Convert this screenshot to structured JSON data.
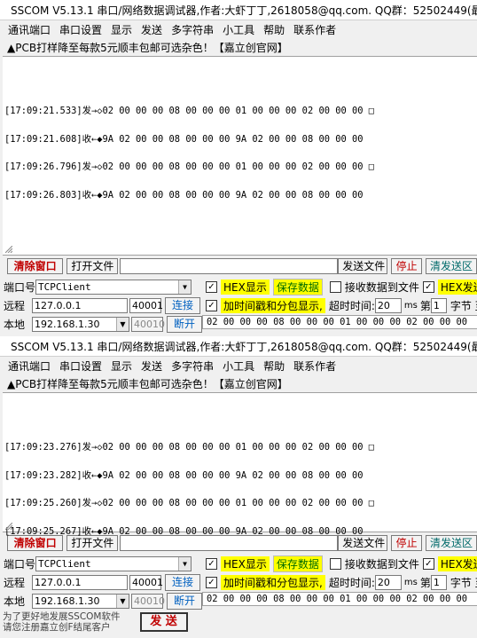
{
  "windows": [
    {
      "title": "SSCOM V5.13.1 串口/网络数据调试器,作者:大虾丁丁,2618058@qq.com. QQ群：52502449(最",
      "menu": [
        "通讯端口",
        "串口设置",
        "显示",
        "发送",
        "多字符串",
        "小工具",
        "帮助",
        "联系作者"
      ],
      "ad_text": "▲PCB打样降至每款5元顺丰包邮可选杂色！【嘉立创官网】",
      "log_lines": [
        "[17:09:21.533]发→◇02 00 00 00 08 00 00 00 01 00 00 00 02 00 00 00 □",
        "[17:09:21.608]收←◆9A 02 00 00 08 00 00 00 9A 02 00 00 08 00 00 00",
        "[17:09:26.796]发→◇02 00 00 00 08 00 00 00 01 00 00 00 02 00 00 00 □",
        "[17:09:26.803]收←◆9A 02 00 00 08 00 00 00 9A 02 00 00 08 00 00 00"
      ],
      "clear_button": "清除窗口",
      "open_file_button": "打开文件",
      "send_file_button": "发送文件",
      "stop_button": "停止",
      "clear_send_button": "清发送区",
      "port_label": "端口号",
      "port_value": "TCPClient",
      "remote_label": "远程",
      "remote_ip": "127.0.0.1",
      "remote_port": "40001",
      "connect_button": "连接",
      "local_label": "本地",
      "local_ip": "192.168.1.30",
      "local_port": "40010",
      "disconnect_button": "断开",
      "hex_display": "HEX显示",
      "save_data": "保存数据",
      "recv_to_file": "接收数据到文件",
      "hex_send": "HEX发送",
      "timestamp_label": "加时间戳和分包显示,",
      "timeout_label": "超时时间:",
      "timeout_value": "20",
      "timeout_unit": "ms",
      "nth_label": "第",
      "nth_value": "1",
      "byte_label": "字节 至",
      "send_hex": "02 00 00 00 08 00 00 00 01 00 00 00 02 00 00 00"
    },
    {
      "title": "SSCOM V5.13.1 串口/网络数据调试器,作者:大虾丁丁,2618058@qq.com. QQ群：52502449(最",
      "menu": [
        "通讯端口",
        "串口设置",
        "显示",
        "发送",
        "多字符串",
        "小工具",
        "帮助",
        "联系作者"
      ],
      "ad_text": "▲PCB打样降至每款5元顺丰包邮可选杂色！【嘉立创官网】",
      "log_lines": [
        "[17:09:23.276]发→◇02 00 00 00 08 00 00 00 01 00 00 00 02 00 00 00 □",
        "[17:09:23.282]收←◆9A 02 00 00 08 00 00 00 9A 02 00 00 08 00 00 00",
        "[17:09:25.260]发→◇02 00 00 00 08 00 00 00 01 00 00 00 02 00 00 00 □",
        "[17:09:25.267]收←◆9A 02 00 00 08 00 00 00 9A 02 00 00 08 00 00 00"
      ],
      "clear_button": "清除窗口",
      "open_file_button": "打开文件",
      "send_file_button": "发送文件",
      "stop_button": "停止",
      "clear_send_button": "清发送区",
      "port_label": "端口号",
      "port_value": "TCPClient",
      "remote_label": "远程",
      "remote_ip": "127.0.0.1",
      "remote_port": "40001",
      "connect_button": "连接",
      "local_label": "本地",
      "local_ip": "192.168.1.30",
      "local_port": "40010",
      "disconnect_button": "断开",
      "hex_display": "HEX显示",
      "save_data": "保存数据",
      "recv_to_file": "接收数据到文件",
      "hex_send": "HEX发送",
      "timestamp_label": "加时间戳和分包显示,",
      "timeout_label": "超时时间:",
      "timeout_value": "20",
      "timeout_unit": "ms",
      "nth_label": "第",
      "nth_value": "1",
      "byte_label": "字节 至",
      "send_hex": "02 00 00 00 08 00 00 00 01 00 00 00 02 00 00 00",
      "promo_line1": "为了更好地发展SSCOM软件",
      "promo_line2": "请您注册嘉立创F结尾客户",
      "send_button": "发 送"
    }
  ],
  "colors": {
    "red_button_text": "#c00000",
    "highlight": "#ffff00",
    "connect_text": "#0060c0"
  },
  "icons": {
    "app": "antenna-icon",
    "dropdown": "chevron-down-icon",
    "checkbox_checked": "checkmark-icon"
  }
}
